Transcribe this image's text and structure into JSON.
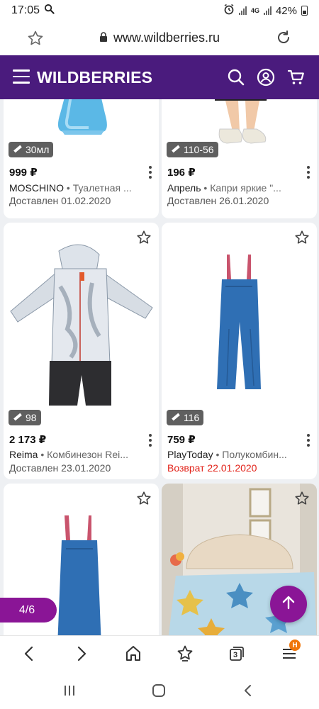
{
  "status_bar": {
    "time": "17:05",
    "network": "4G",
    "battery": "42%"
  },
  "browser": {
    "url": "www.wildberries.ru",
    "tabs_count": "3",
    "menu_badge": "H"
  },
  "header": {
    "logo": "WILDBERRIES"
  },
  "products": [
    {
      "size": "30мл",
      "price": "999 ₽",
      "brand": "MOSCHINO",
      "name": "Туалетная ...",
      "status": "Доставлен 01.02.2020",
      "status_type": "delivered"
    },
    {
      "size": "110-56",
      "price": "196 ₽",
      "brand": "Апрель",
      "name": "Капри яркие \"...",
      "status": "Доставлен 26.01.2020",
      "status_type": "delivered"
    },
    {
      "size": "98",
      "price": "2 173 ₽",
      "brand": "Reima",
      "name": "Комбинезон Rei...",
      "status": "Доставлен 23.01.2020",
      "status_type": "delivered"
    },
    {
      "size": "116",
      "price": "759 ₽",
      "brand": "PlayToday",
      "name": "Полукомбин...",
      "status": "Возврат 22.01.2020",
      "status_type": "return"
    }
  ],
  "pager": {
    "text": "4/6"
  },
  "colors": {
    "header": "#4a1b7d",
    "accent": "#8a1596",
    "return_status": "#e2231a",
    "badge": "#f0760a"
  }
}
